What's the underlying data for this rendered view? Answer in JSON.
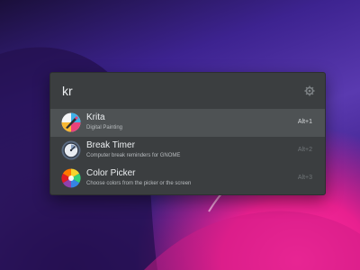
{
  "search": {
    "query": "kr"
  },
  "results": [
    {
      "name": "Krita",
      "description": "Digital Painting",
      "shortcut": "Alt+1",
      "icon": "krita-icon",
      "selected": true
    },
    {
      "name": "Break Timer",
      "description": "Computer break reminders for GNOME",
      "shortcut": "Alt+2",
      "icon": "break-timer-icon",
      "selected": false
    },
    {
      "name": "Color Picker",
      "description": "Choose colors from the picker or the screen",
      "shortcut": "Alt+3",
      "icon": "color-picker-icon",
      "selected": false
    }
  ],
  "colors": {
    "panel_bg": "#3b3e40",
    "selected_bg": "#4e5254",
    "wallpaper_accent": "#ff2fa0"
  }
}
